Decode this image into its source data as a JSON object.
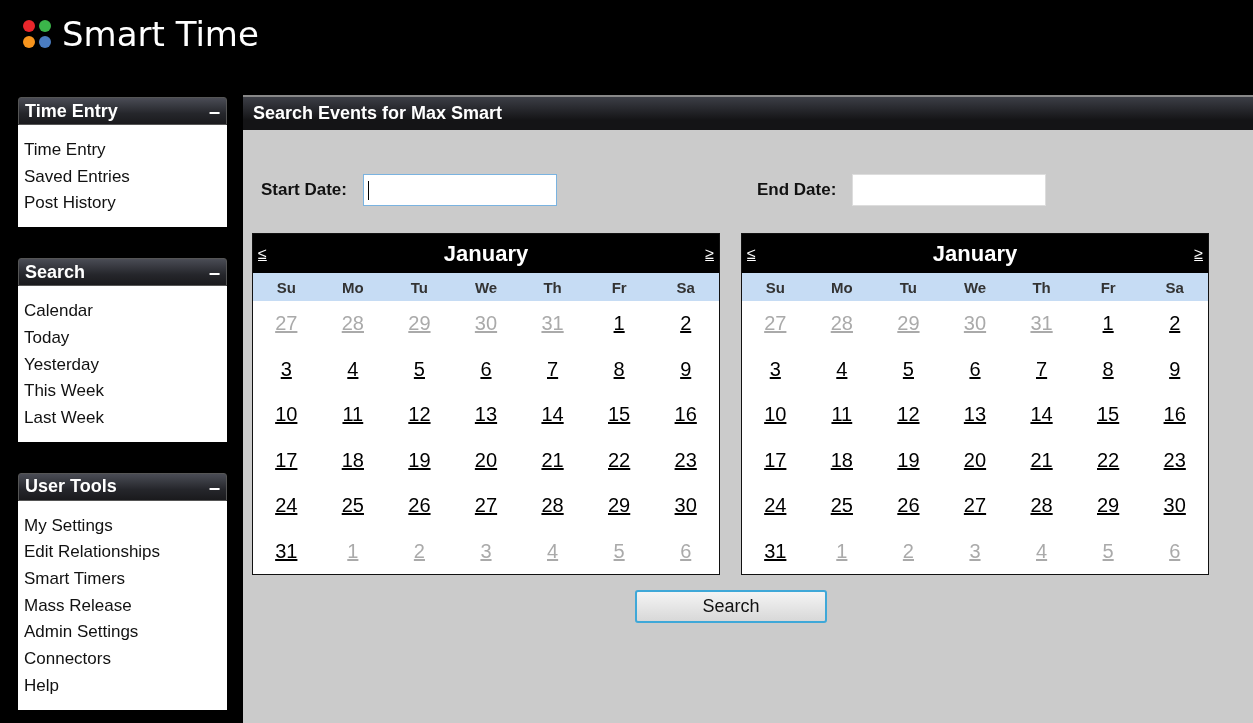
{
  "app": {
    "title": "Smart Time"
  },
  "sidebar": [
    {
      "title": "Time Entry",
      "collapse": "–",
      "items": [
        "Time Entry",
        "Saved Entries",
        "Post History"
      ]
    },
    {
      "title": "Search",
      "collapse": "–",
      "items": [
        "Calendar",
        "Today",
        "Yesterday",
        "This Week",
        "Last Week"
      ]
    },
    {
      "title": "User Tools",
      "collapse": "–",
      "items": [
        "My Settings",
        "Edit Relationships",
        "Smart Timers",
        "Mass Release",
        "Admin Settings",
        "Connectors",
        "Help"
      ]
    }
  ],
  "main": {
    "title": "Search Events for Max Smart",
    "start_date": {
      "label": "Start Date:",
      "focused": true
    },
    "end_date": {
      "label": "End Date:",
      "focused": false
    },
    "calendars": [
      {
        "prev": "≤",
        "month": "January",
        "next": "≥",
        "weekdays": [
          "Su",
          "Mo",
          "Tu",
          "We",
          "Th",
          "Fr",
          "Sa"
        ],
        "weeks": [
          [
            {
              "label": "27",
              "outside": true
            },
            {
              "label": "28",
              "outside": true
            },
            {
              "label": "29",
              "outside": true
            },
            {
              "label": "30",
              "outside": true
            },
            {
              "label": "31",
              "outside": true
            },
            {
              "label": "1",
              "outside": false
            },
            {
              "label": "2",
              "outside": false
            }
          ],
          [
            {
              "label": "3",
              "outside": false
            },
            {
              "label": "4",
              "outside": false
            },
            {
              "label": "5",
              "outside": false
            },
            {
              "label": "6",
              "outside": false
            },
            {
              "label": "7",
              "outside": false
            },
            {
              "label": "8",
              "outside": false
            },
            {
              "label": "9",
              "outside": false
            }
          ],
          [
            {
              "label": "10",
              "outside": false
            },
            {
              "label": "11",
              "outside": false
            },
            {
              "label": "12",
              "outside": false
            },
            {
              "label": "13",
              "outside": false
            },
            {
              "label": "14",
              "outside": false
            },
            {
              "label": "15",
              "outside": false
            },
            {
              "label": "16",
              "outside": false
            }
          ],
          [
            {
              "label": "17",
              "outside": false
            },
            {
              "label": "18",
              "outside": false
            },
            {
              "label": "19",
              "outside": false
            },
            {
              "label": "20",
              "outside": false
            },
            {
              "label": "21",
              "outside": false
            },
            {
              "label": "22",
              "outside": false
            },
            {
              "label": "23",
              "outside": false
            }
          ],
          [
            {
              "label": "24",
              "outside": false
            },
            {
              "label": "25",
              "outside": false
            },
            {
              "label": "26",
              "outside": false
            },
            {
              "label": "27",
              "outside": false
            },
            {
              "label": "28",
              "outside": false
            },
            {
              "label": "29",
              "outside": false
            },
            {
              "label": "30",
              "outside": false
            }
          ],
          [
            {
              "label": "31",
              "outside": false
            },
            {
              "label": "1",
              "outside": true
            },
            {
              "label": "2",
              "outside": true
            },
            {
              "label": "3",
              "outside": true
            },
            {
              "label": "4",
              "outside": true
            },
            {
              "label": "5",
              "outside": true
            },
            {
              "label": "6",
              "outside": true
            }
          ]
        ]
      },
      {
        "prev": "≤",
        "month": "January",
        "next": "≥",
        "weekdays": [
          "Su",
          "Mo",
          "Tu",
          "We",
          "Th",
          "Fr",
          "Sa"
        ],
        "weeks": [
          [
            {
              "label": "27",
              "outside": true
            },
            {
              "label": "28",
              "outside": true
            },
            {
              "label": "29",
              "outside": true
            },
            {
              "label": "30",
              "outside": true
            },
            {
              "label": "31",
              "outside": true
            },
            {
              "label": "1",
              "outside": false
            },
            {
              "label": "2",
              "outside": false
            }
          ],
          [
            {
              "label": "3",
              "outside": false
            },
            {
              "label": "4",
              "outside": false
            },
            {
              "label": "5",
              "outside": false
            },
            {
              "label": "6",
              "outside": false
            },
            {
              "label": "7",
              "outside": false
            },
            {
              "label": "8",
              "outside": false
            },
            {
              "label": "9",
              "outside": false
            }
          ],
          [
            {
              "label": "10",
              "outside": false
            },
            {
              "label": "11",
              "outside": false
            },
            {
              "label": "12",
              "outside": false
            },
            {
              "label": "13",
              "outside": false
            },
            {
              "label": "14",
              "outside": false
            },
            {
              "label": "15",
              "outside": false
            },
            {
              "label": "16",
              "outside": false
            }
          ],
          [
            {
              "label": "17",
              "outside": false
            },
            {
              "label": "18",
              "outside": false
            },
            {
              "label": "19",
              "outside": false
            },
            {
              "label": "20",
              "outside": false
            },
            {
              "label": "21",
              "outside": false
            },
            {
              "label": "22",
              "outside": false
            },
            {
              "label": "23",
              "outside": false
            }
          ],
          [
            {
              "label": "24",
              "outside": false
            },
            {
              "label": "25",
              "outside": false
            },
            {
              "label": "26",
              "outside": false
            },
            {
              "label": "27",
              "outside": false
            },
            {
              "label": "28",
              "outside": false
            },
            {
              "label": "29",
              "outside": false
            },
            {
              "label": "30",
              "outside": false
            }
          ],
          [
            {
              "label": "31",
              "outside": false
            },
            {
              "label": "1",
              "outside": true
            },
            {
              "label": "2",
              "outside": true
            },
            {
              "label": "3",
              "outside": true
            },
            {
              "label": "4",
              "outside": true
            },
            {
              "label": "5",
              "outside": true
            },
            {
              "label": "6",
              "outside": true
            }
          ]
        ]
      }
    ],
    "search_button": "Search"
  }
}
